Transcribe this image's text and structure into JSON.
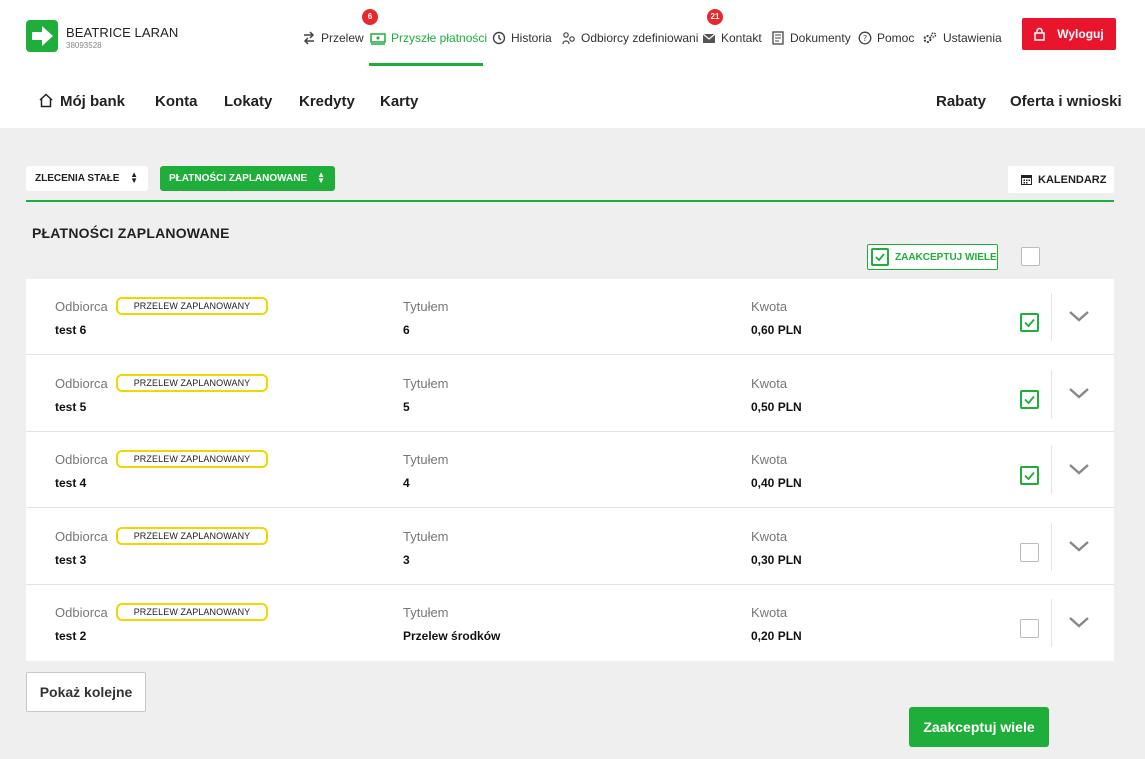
{
  "user": {
    "name": "BEATRICE LARAN",
    "id": "38093528"
  },
  "topnav": {
    "przelew": "Przelew",
    "przyszle": "Przyszłe płatności",
    "przyszle_badge": "6",
    "historia": "Historia",
    "odbiorcy": "Odbiorcy zdefiniowani",
    "kontakt": "Kontakt",
    "kontakt_badge": "21",
    "dokumenty": "Dokumenty",
    "pomoc": "Pomoc",
    "ustawienia": "Ustawienia",
    "logout": "Wyloguj"
  },
  "mainnav": {
    "home": "Mój bank",
    "konta": "Konta",
    "lokaty": "Lokaty",
    "kredyty": "Kredyty",
    "karty": "Karty",
    "rabaty": "Rabaty",
    "oferta": "Oferta i wnioski"
  },
  "filters": {
    "standing_orders": "ZLECENIA STAŁE",
    "scheduled": "PŁATNOŚCI ZAPLANOWANE",
    "calendar": "KALENDARZ"
  },
  "section": {
    "title": "PŁATNOŚCI ZAPLANOWANE",
    "accept_many_small": "ZAAKCEPTUJ WIELE"
  },
  "labels": {
    "recipient": "Odbiorca",
    "title": "Tytułem",
    "amount": "Kwota",
    "tag": "PRZELEW ZAPLANOWANY"
  },
  "rows": [
    {
      "recipient": "test 6",
      "title": "6",
      "amount": "0,60 PLN",
      "checked": true
    },
    {
      "recipient": "test 5",
      "title": "5",
      "amount": "0,50 PLN",
      "checked": true
    },
    {
      "recipient": "test 4",
      "title": "4",
      "amount": "0,40 PLN",
      "checked": true
    },
    {
      "recipient": "test 3",
      "title": "3",
      "amount": "0,30 PLN",
      "checked": false
    },
    {
      "recipient": "test 2",
      "title": "Przelew środków",
      "amount": "0,20 PLN",
      "checked": false
    }
  ],
  "buttons": {
    "show_more": "Pokaż kolejne",
    "accept_many": "Zaakceptuj wiele"
  },
  "colors": {
    "accent": "#1fae3a",
    "danger": "#e8152d",
    "tag_border": "#f2d600"
  }
}
